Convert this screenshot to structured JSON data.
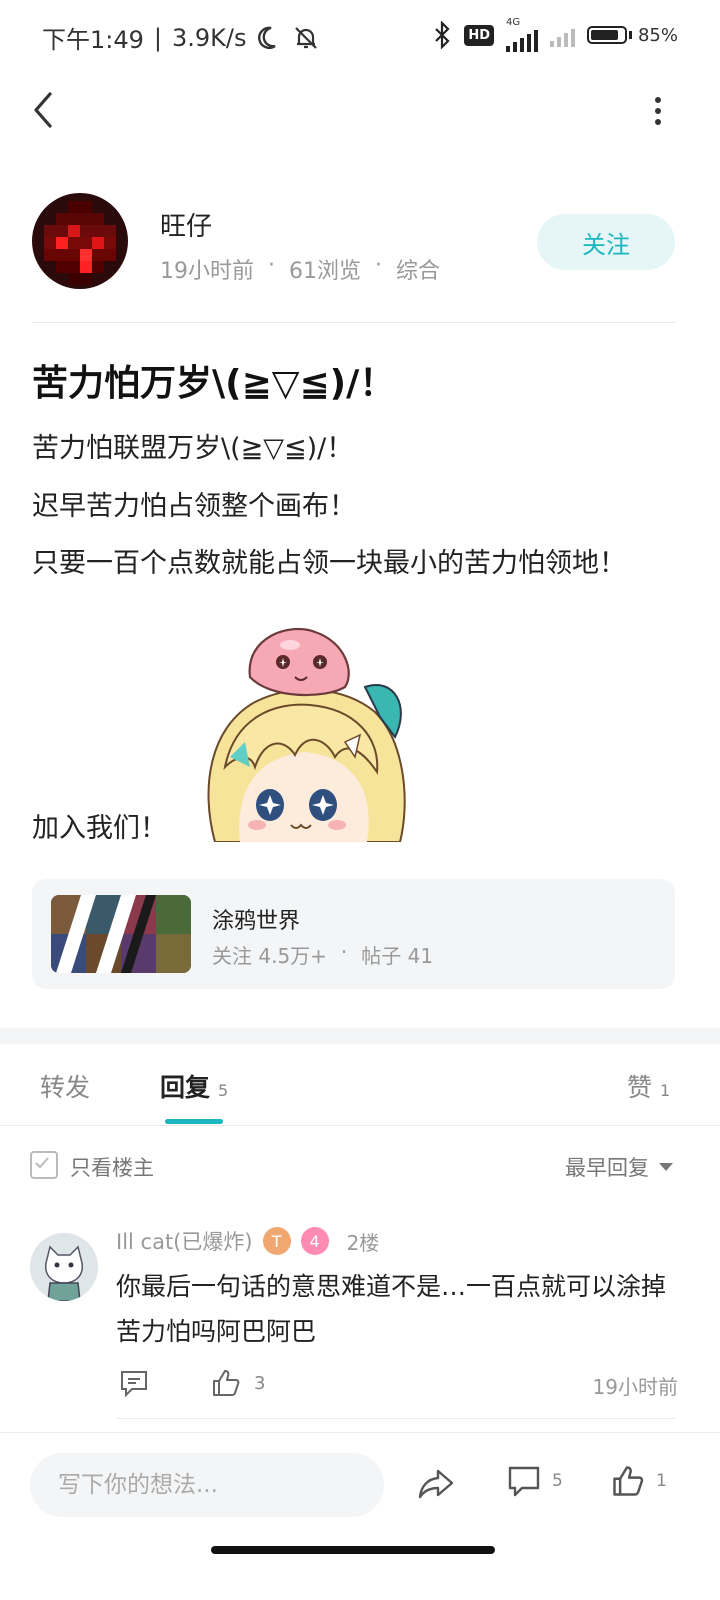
{
  "status_bar": {
    "time": "下午1:49",
    "speed": "3.9K/s",
    "hd": "HD",
    "network": "4G",
    "battery": "85%",
    "battery_level": 0.85
  },
  "author": {
    "name": "旺仔",
    "time_ago": "19小时前",
    "views": "61浏览",
    "category": "综合",
    "follow_label": "关注"
  },
  "post": {
    "title": "苦力怕万岁\\(≧▽≦)/！",
    "lines": [
      "苦力怕联盟万岁\\(≧▽≦)/！",
      "迟早苦力怕占领整个画布！",
      "只要一百个点数就能占领一块最小的苦力怕领地！",
      "加入我们！"
    ]
  },
  "community": {
    "name": "涂鸦世界",
    "followers": "关注 4.5万+",
    "posts": "帖子 41"
  },
  "tabs": {
    "forward": "转发",
    "reply": "回复",
    "reply_count": "5",
    "like": "赞",
    "like_count": "1"
  },
  "filter": {
    "only_op": "只看楼主",
    "sort": "最早回复"
  },
  "reply": {
    "username": "Ill cat(已爆炸)",
    "badge_t": "T",
    "badge_level": "4",
    "floor": "2楼",
    "content": "你最后一句话的意思难道不是…一百点就可以涂掉苦力怕吗阿巴阿巴",
    "likes": "3",
    "time_ago": "19小时前"
  },
  "bottom_bar": {
    "placeholder": "写下你的想法...",
    "comment_count": "5",
    "like_count": "1"
  }
}
